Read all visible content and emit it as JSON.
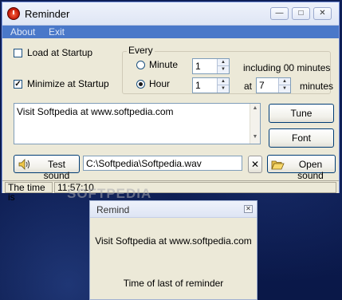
{
  "window": {
    "title": "Reminder",
    "icon": "alarm-clock-icon",
    "controls": {
      "minimize": "—",
      "maximize": "□",
      "close": "✕"
    }
  },
  "menu": {
    "items": [
      "About",
      "Exit"
    ]
  },
  "options": {
    "load_at_startup": {
      "label": "Load at Startup",
      "checked": false,
      "mark": ""
    },
    "minimize_at_startup": {
      "label": "Minimize at Startup",
      "checked": true,
      "mark": "✓"
    }
  },
  "every": {
    "legend": "Every",
    "minute": {
      "label": "Minute",
      "value": "1",
      "selected": false,
      "note": "including 00 minutes"
    },
    "hour": {
      "label": "Hour",
      "value": "1",
      "selected": true,
      "at_label": "at",
      "at_value": "7",
      "minutes_label": "minutes"
    },
    "spin_up": "▲",
    "spin_down": "▼"
  },
  "message": {
    "text": "Visit Softpedia at www.softpedia.com",
    "scroll_up": "▲",
    "scroll_down": "▼"
  },
  "buttons": {
    "tune": "Tune",
    "font": "Font",
    "test_sound": "Test sound",
    "clear": "✕",
    "open_sound": "Open sound"
  },
  "sound_file": {
    "value": "C:\\Softpedia\\Softpedia.wav"
  },
  "status": {
    "label": "The time is",
    "time": "11:57:10"
  },
  "watermark": "SOFTPEDIA",
  "remind_popup": {
    "title": "Remind",
    "close": "✕",
    "message": "Visit Softpedia at www.softpedia.com",
    "footer": "Time of last of reminder"
  },
  "colors": {
    "menubar": "#4a78c9",
    "desktop": "#0f1f54",
    "face": "#ece9d8"
  }
}
